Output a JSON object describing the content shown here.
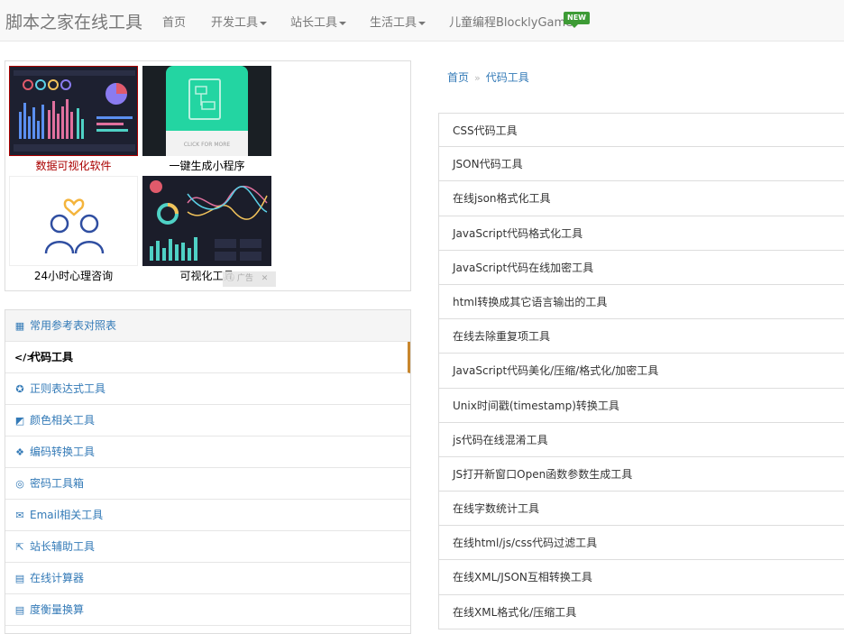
{
  "navbar": {
    "brand": "脚本之家在线工具",
    "items": [
      {
        "label": "首页"
      },
      {
        "label": "开发工具"
      },
      {
        "label": "站长工具"
      },
      {
        "label": "生活工具"
      },
      {
        "label": "儿童编程BlocklyGame"
      }
    ],
    "new_badge": "NEW"
  },
  "ads": {
    "tiles": [
      {
        "caption": "数据可视化软件"
      },
      {
        "caption": "一键生成小程序",
        "image_text": "CLICK FOR MORE"
      },
      {
        "caption": "24小时心理咨询"
      },
      {
        "caption": "可视化工具"
      }
    ],
    "ad_label": "广告"
  },
  "categories": [
    {
      "label": "常用参考表对照表",
      "icon": "table-icon"
    },
    {
      "label": "代码工具",
      "icon": "code-icon"
    },
    {
      "label": "正则表达式工具",
      "icon": "gear-icon"
    },
    {
      "label": "颜色相关工具",
      "icon": "palette-icon"
    },
    {
      "label": "编码转换工具",
      "icon": "cubes-icon"
    },
    {
      "label": "密码工具箱",
      "icon": "lock-icon"
    },
    {
      "label": "Email相关工具",
      "icon": "envelope-icon"
    },
    {
      "label": "站长辅助工具",
      "icon": "share-icon"
    },
    {
      "label": "在线计算器",
      "icon": "calculator-icon"
    },
    {
      "label": "度衡量换算",
      "icon": "calculator-icon"
    }
  ],
  "breadcrumb": {
    "home": "首页",
    "separator": "»",
    "current": "代码工具"
  },
  "tools": [
    "CSS代码工具",
    "JSON代码工具",
    "在线json格式化工具",
    "JavaScript代码格式化工具",
    "JavaScript代码在线加密工具",
    "html转换成其它语言输出的工具",
    "在线去除重复项工具",
    "JavaScript代码美化/压缩/格式化/加密工具",
    "Unix时间戳(timestamp)转换工具",
    "js代码在线混淆工具",
    "JS打开新窗口Open函数参数生成工具",
    "在线字数统计工具",
    "在线html/js/css代码过滤工具",
    "在线XML/JSON互相转换工具",
    "在线XML格式化/压缩工具"
  ]
}
